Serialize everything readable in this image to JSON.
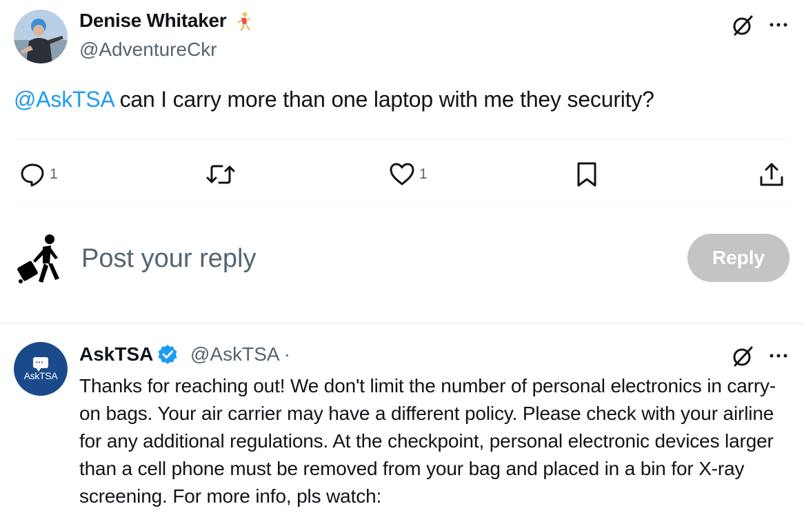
{
  "tweet": {
    "author_name": "Denise Whitaker",
    "author_handle": "@AdventureCkr",
    "mention": "@AskTSA",
    "text": "can I carry more than one laptop with me they security?",
    "actions": {
      "reply_count": "1",
      "like_count": "1"
    }
  },
  "composer": {
    "placeholder": "Post your reply",
    "reply_label": "Reply"
  },
  "reply": {
    "author_name": "AskTSA",
    "author_handle": "@AskTSA ·",
    "avatar_text": "AskTSA",
    "text": "Thanks for reaching out! We don't limit the number of personal electronics in carry-on bags. Your air carrier may have a different policy. Please check with your airline for any additional regulations. At the checkpoint, personal electronic devices larger than a cell phone must be removed from your bag and placed in a bin for X-ray screening. For more info, pls watch:"
  },
  "colors": {
    "accent": "#1d9bf0",
    "secondary_text": "#536471",
    "reply_button_disabled": "#c4c4c4",
    "tsa_blue": "#1b4a8b"
  },
  "icons": [
    "runner-emoji-icon",
    "grok-icon",
    "more-icon",
    "reply-icon",
    "retweet-icon",
    "like-icon",
    "bookmark-icon",
    "share-icon",
    "traveler-avatar-icon",
    "verified-badge-icon"
  ]
}
